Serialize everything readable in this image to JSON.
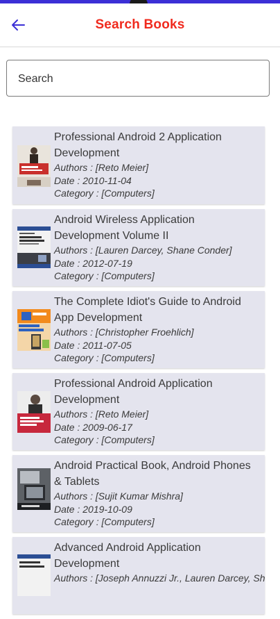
{
  "app": {
    "title": "Search Books"
  },
  "search": {
    "placeholder": "Search",
    "value": ""
  },
  "books": [
    {
      "title": "Professional Android 2 Application Development",
      "authors": "Authors : [Reto Meier]",
      "date": "Date : 2010-11-04",
      "category": "Category : [Computers]"
    },
    {
      "title": "Android Wireless Application Development Volume II",
      "authors": "Authors : [Lauren Darcey, Shane Conder]",
      "date": "Date : 2012-07-19",
      "category": "Category : [Computers]"
    },
    {
      "title": "The Complete Idiot's Guide to Android App Development",
      "authors": "Authors : [Christopher Froehlich]",
      "date": "Date : 2011-07-05",
      "category": "Category : [Computers]"
    },
    {
      "title": "Professional Android Application Development",
      "authors": "Authors : [Reto Meier]",
      "date": "Date : 2009-06-17",
      "category": "Category : [Computers]"
    },
    {
      "title": "Android Practical Book, Android Phones & Tablets",
      "authors": "Authors : [Sujit Kumar Mishra]",
      "date": "Date : 2019-10-09",
      "category": "Category : [Computers]"
    },
    {
      "title": "Advanced Android Application Development",
      "authors": "Authors : [Joseph Annuzzi Jr., Lauren Darcey, Sh",
      "date": "",
      "category": ""
    }
  ],
  "icons": {
    "back": "arrow-left-icon"
  },
  "colors": {
    "accent": "#f02a1e",
    "back_arrow": "#3b2fd6",
    "card": "#e4e4ee"
  }
}
